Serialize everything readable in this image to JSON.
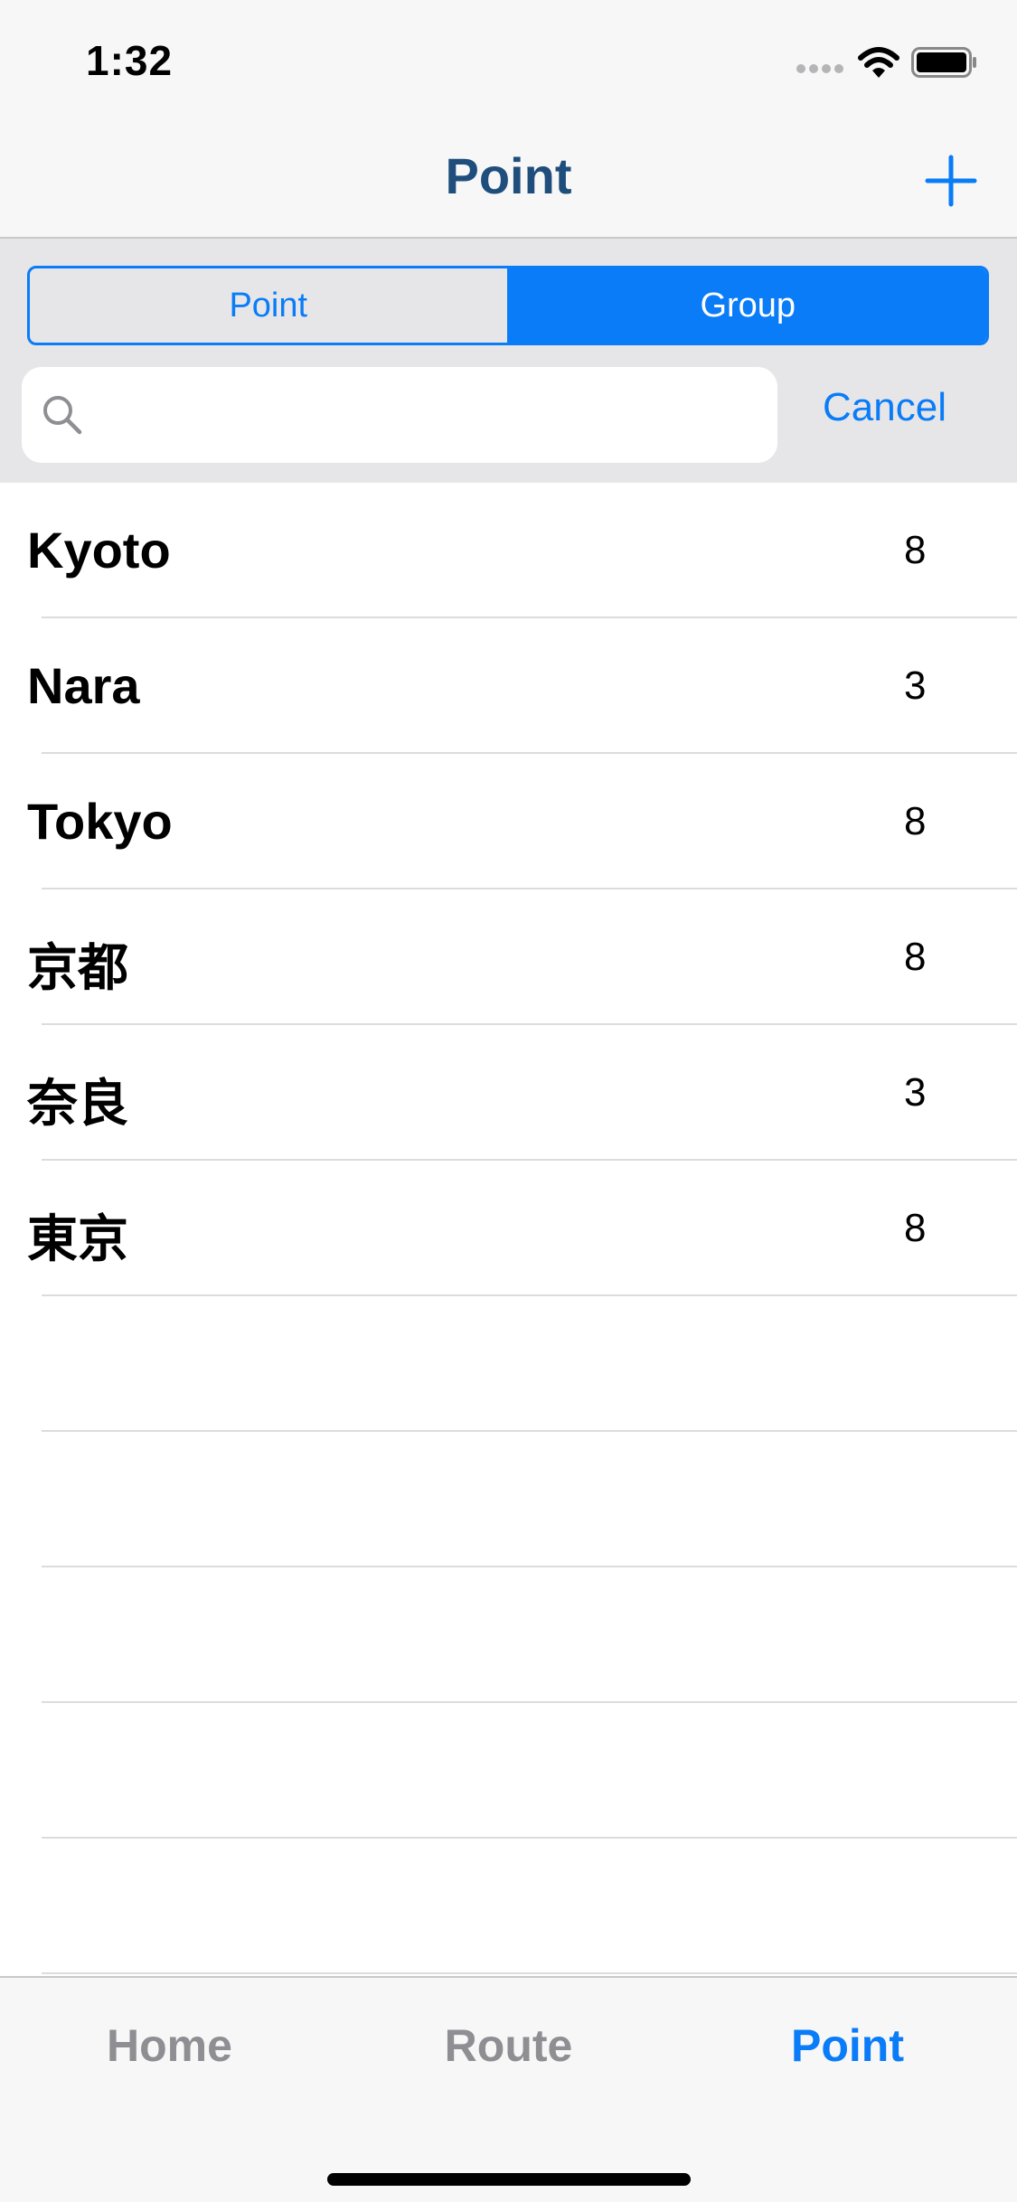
{
  "status_bar": {
    "time": "1:32"
  },
  "nav": {
    "title": "Point",
    "add_icon": "plus-icon"
  },
  "segmented_control": {
    "segments": [
      {
        "label": "Point",
        "selected": false
      },
      {
        "label": "Group",
        "selected": true
      }
    ]
  },
  "search": {
    "value": "",
    "placeholder": "",
    "cancel_label": "Cancel"
  },
  "groups": [
    {
      "name": "Kyoto",
      "count": "8"
    },
    {
      "name": "Nara",
      "count": "3"
    },
    {
      "name": "Tokyo",
      "count": "8"
    },
    {
      "name": "京都",
      "count": "8"
    },
    {
      "name": "奈良",
      "count": "3"
    },
    {
      "name": "東京",
      "count": "8"
    }
  ],
  "tab_bar": {
    "tabs": [
      {
        "label": "Home",
        "active": false
      },
      {
        "label": "Route",
        "active": false
      },
      {
        "label": "Point",
        "active": true
      }
    ]
  },
  "colors": {
    "accent": "#0a7cf7",
    "nav_title": "#1f4e7c",
    "inactive_tab": "#8e8e93"
  }
}
